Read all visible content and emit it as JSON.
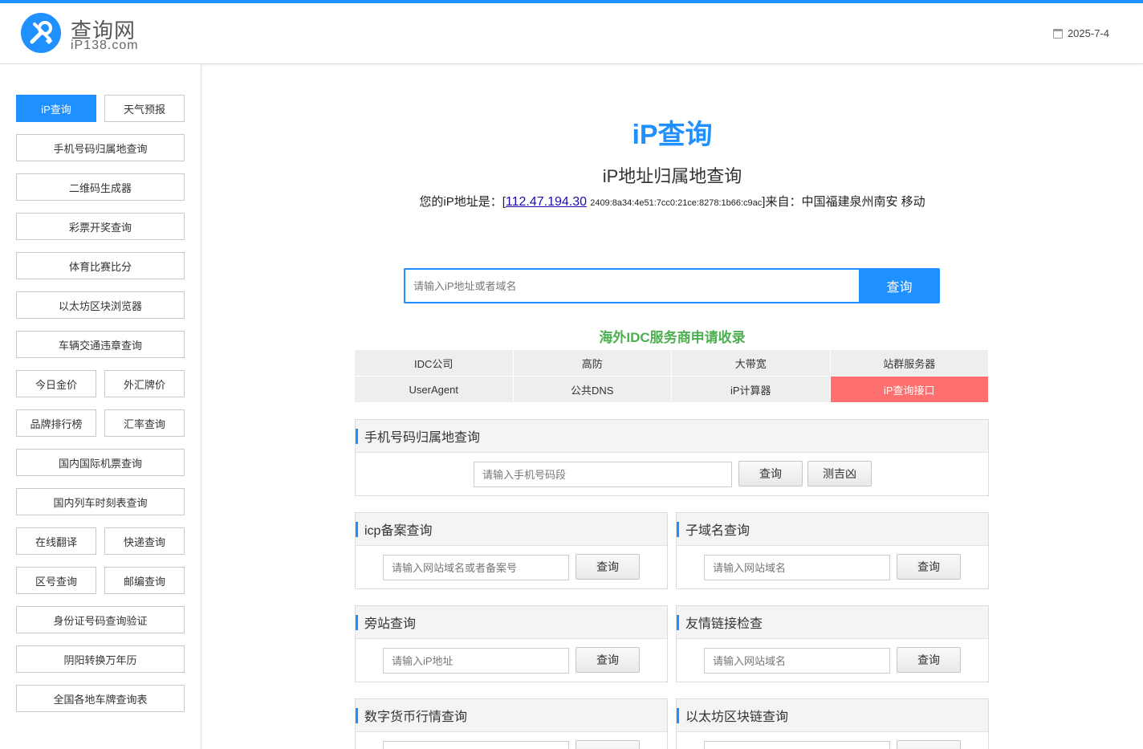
{
  "header": {
    "logo_cn": "查询网",
    "logo_en": "iP138.com",
    "date": "2025-7-4"
  },
  "sidebar": {
    "items": [
      {
        "label": "iP查询",
        "active": true
      },
      {
        "label": "天气预报"
      },
      {
        "label": "手机号码归属地查询"
      },
      {
        "label": "二维码生成器"
      },
      {
        "label": "彩票开奖查询"
      },
      {
        "label": "体育比赛比分"
      },
      {
        "label": "以太坊区块浏览器"
      },
      {
        "label": "车辆交通违章查询"
      },
      {
        "label": "今日金价"
      },
      {
        "label": "外汇牌价"
      },
      {
        "label": "品牌排行榜"
      },
      {
        "label": "汇率查询"
      },
      {
        "label": "国内国际机票查询"
      },
      {
        "label": "国内列车时刻表查询"
      },
      {
        "label": "在线翻译"
      },
      {
        "label": "快递查询"
      },
      {
        "label": "区号查询"
      },
      {
        "label": "邮编查询"
      },
      {
        "label": "身份证号码查询验证"
      },
      {
        "label": "阴阳转换万年历"
      },
      {
        "label": "全国各地车牌查询表"
      }
    ]
  },
  "main": {
    "title": "iP查询",
    "subtitle": "iP地址归属地查询",
    "ip_prefix": "您的iP地址是：[",
    "ip_v4": "112.47.194.30",
    "ip_v6": "2409:8a34:4e51:7cc0:21ce:8278:1b66:c9ac",
    "ip_suffix": "]来自：中国福建泉州南安 移动",
    "search_placeholder": "请输入iP地址或者域名",
    "search_button": "查询",
    "idc_title": "海外IDC服务商申请收录",
    "grid": [
      "IDC公司",
      "高防",
      "大带宽",
      "站群服务器",
      "UserAgent",
      "公共DNS",
      "iP计算器",
      "iP查询接口"
    ]
  },
  "panels": {
    "phone": {
      "title": "手机号码归属地查询",
      "placeholder": "请输入手机号码段",
      "button": "查询",
      "button2": "测吉凶"
    },
    "icp": {
      "title": "icp备案查询",
      "placeholder": "请输入网站域名或者备案号",
      "button": "查询"
    },
    "subdomain": {
      "title": "子域名查询",
      "placeholder": "请输入网站域名",
      "button": "查询"
    },
    "sidesite": {
      "title": "旁站查询",
      "placeholder": "请输入iP地址",
      "button": "查询"
    },
    "friendlink": {
      "title": "友情链接检查",
      "placeholder": "请输入网站域名",
      "button": "查询"
    },
    "crypto": {
      "title": "数字货币行情查询"
    },
    "eth": {
      "title": "以太坊区块链查询"
    }
  }
}
